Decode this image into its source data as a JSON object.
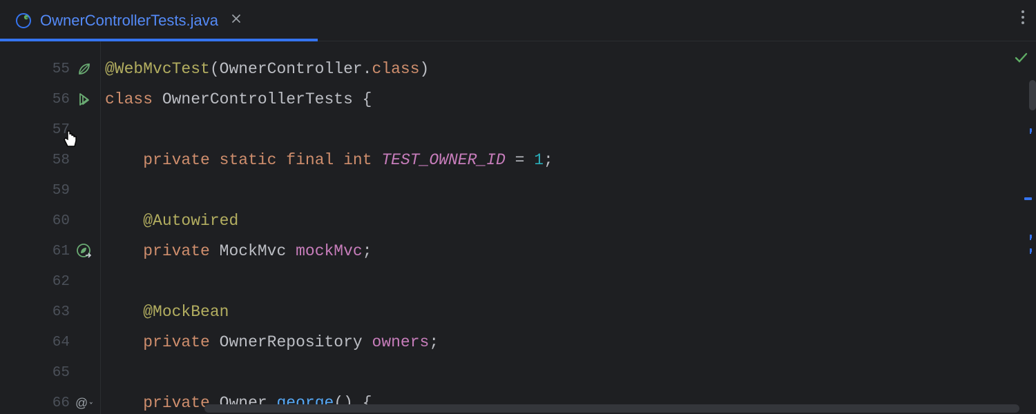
{
  "tab": {
    "title": "OwnerControllerTests.java",
    "icon": "java-class-icon"
  },
  "gutter": {
    "lines": [
      "55",
      "56",
      "57",
      "58",
      "59",
      "60",
      "61",
      "62",
      "63",
      "64",
      "65",
      "66"
    ],
    "icons": {
      "55": "spring-leaf-icon",
      "56": "run-test-icon",
      "61": "spring-bean-nav-icon",
      "66": "override-icon"
    }
  },
  "code": {
    "l55": {
      "ann": "@WebMvcTest",
      "p1": "(",
      "type": "OwnerController",
      "dot": ".",
      "kw": "class",
      "p2": ")"
    },
    "l56": {
      "kw": "class",
      "name": "OwnerControllerTests",
      "brace": " {"
    },
    "l58": {
      "ind": "    ",
      "k1": "private",
      "k2": "static",
      "k3": "final",
      "k4": "int",
      "id": "TEST_OWNER_ID",
      "eq": " = ",
      "num": "1",
      "semi": ";"
    },
    "l60": {
      "ind": "    ",
      "ann": "@Autowired"
    },
    "l61": {
      "ind": "    ",
      "kw": "private",
      "type": "MockMvc",
      "var": "mockMvc",
      "semi": ";"
    },
    "l63": {
      "ind": "    ",
      "ann": "@MockBean"
    },
    "l64": {
      "ind": "    ",
      "kw": "private",
      "type": "OwnerRepository",
      "var": "owners",
      "semi": ";"
    },
    "l66": {
      "ind": "    ",
      "kw": "private",
      "type": "Owner",
      "fn": "george",
      "tail": "() {"
    }
  }
}
